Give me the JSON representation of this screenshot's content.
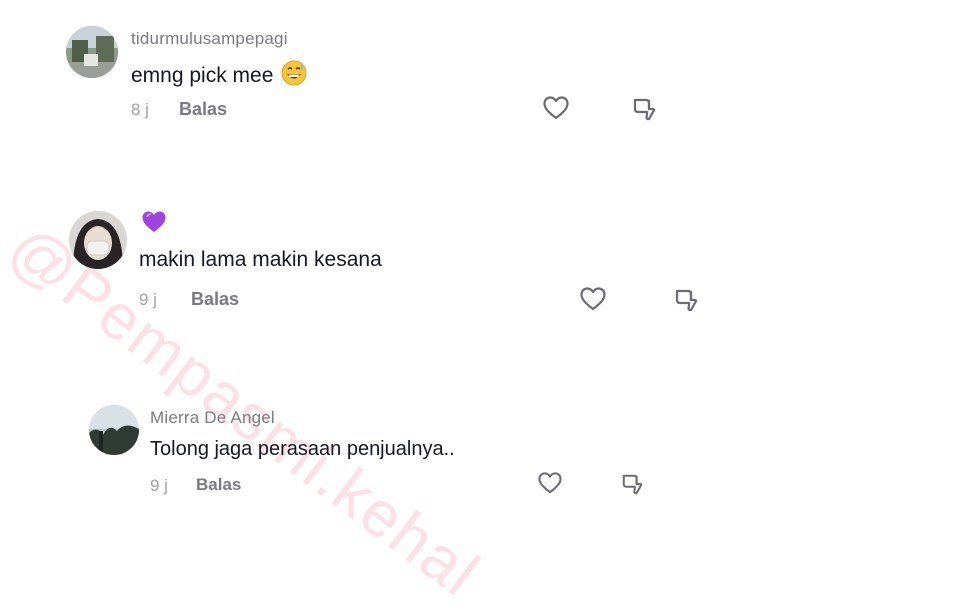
{
  "watermark": "@Pempasmi.kehal",
  "comments": [
    {
      "username": "tidurmulusampepagi",
      "text": "emng pick mee",
      "emoji": "grinning-sweat-emoji",
      "time": "8 j",
      "reply_label": "Balas"
    },
    {
      "username_emoji": "purple-heart-emoji",
      "text": "makin lama makin kesana",
      "time": "9 j",
      "reply_label": "Balas"
    },
    {
      "username": "Mierra De Angel",
      "text": "Tolong jaga perasaan penjualnya..",
      "time": "9 j",
      "reply_label": "Balas"
    }
  ],
  "icons": {
    "like": "heart-outline-icon",
    "dislike": "thumbs-down-icon"
  }
}
